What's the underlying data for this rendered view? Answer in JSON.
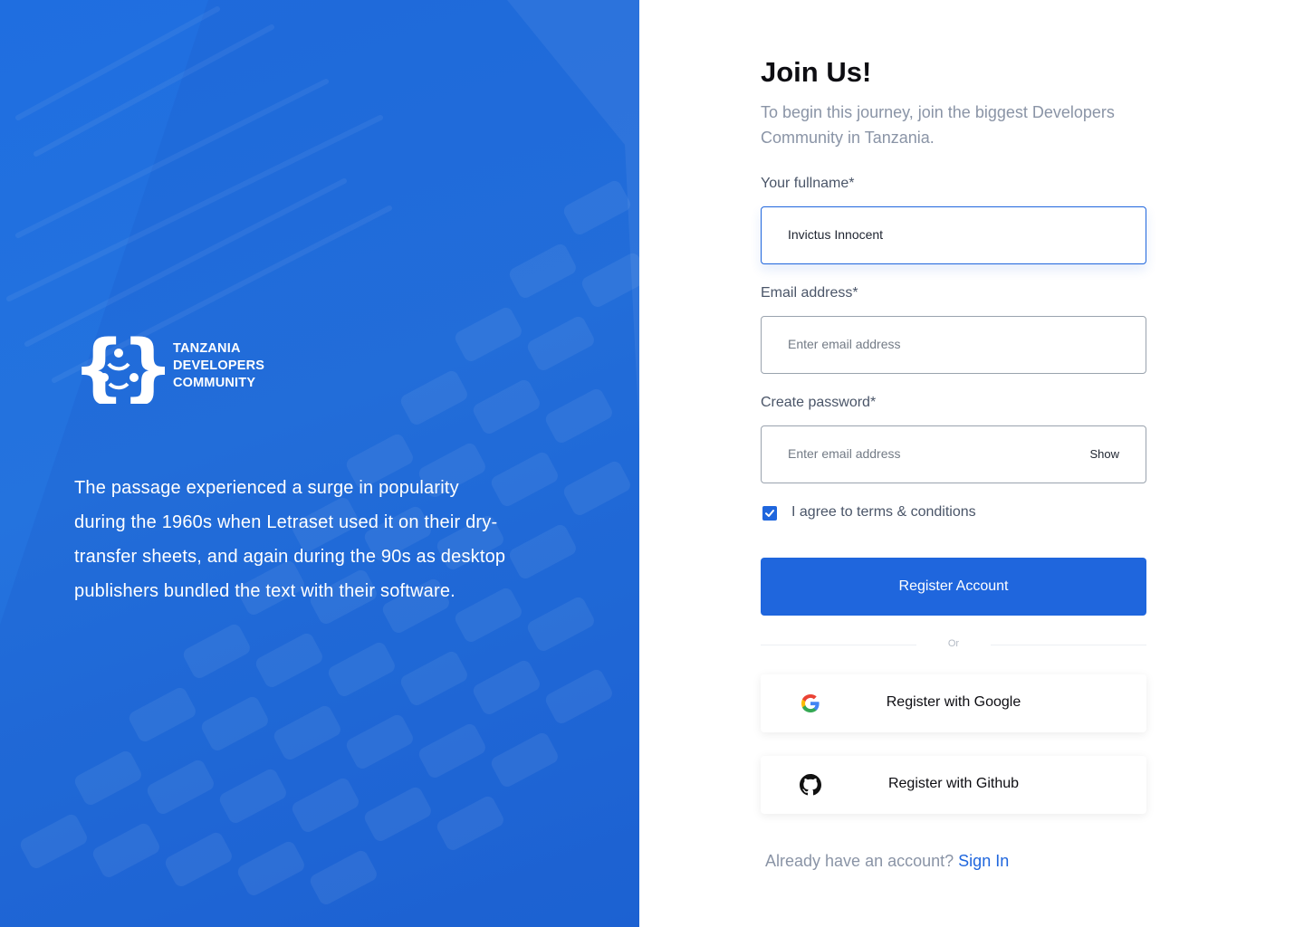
{
  "brand": {
    "line1": "TANZANIA",
    "line2": "DEVELOPERS",
    "line3": "COMMUNITY"
  },
  "tagline": "The passage experienced a surge in popularity during the 1960s when Letraset used it on their dry-transfer sheets, and again during the 90s as desktop publishers bundled the text with their software.",
  "header": {
    "title": "Join Us!",
    "subtitle": "To begin this journey, join the biggest Developers Community in Tanzania."
  },
  "form": {
    "fullname": {
      "label": "Your fullname*",
      "value": "Invictus Innocent"
    },
    "email": {
      "label": "Email address*",
      "placeholder": "Enter email address"
    },
    "password": {
      "label": "Create password*",
      "placeholder": "Enter email address",
      "toggle": "Show"
    },
    "terms": {
      "label": "I agree to terms & conditions",
      "checked": true
    },
    "submit": "Register Account"
  },
  "divider_text": "Or",
  "social": {
    "google": {
      "label": "Register with Google",
      "icon": "google-icon"
    },
    "github": {
      "label": "Register with Github",
      "icon": "github-icon"
    }
  },
  "footer": {
    "prompt": "Already have an account?",
    "link": "Sign In"
  },
  "colors": {
    "primary": "#1f66dd",
    "panel": "#1f6ee0",
    "muted": "#8a94a6"
  }
}
